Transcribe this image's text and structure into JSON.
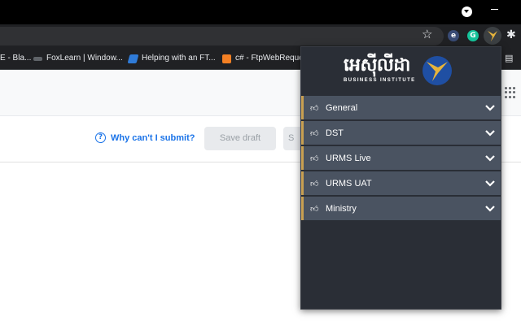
{
  "browser": {
    "bookmarks": [
      {
        "label": "E - Bla...",
        "icon": "bookmark-favicon"
      },
      {
        "label": "FoxLearn | Window...",
        "icon": "foxlearn-favicon"
      },
      {
        "label": "Helping with an FT...",
        "icon": "stackoverflow-favicon"
      },
      {
        "label": "c# - FtpWebReques",
        "icon": "stackoverflow-favicon"
      }
    ],
    "extensions": [
      {
        "name": "e-extension-icon",
        "glyph": "e"
      },
      {
        "name": "grammarly-icon",
        "glyph": "G"
      },
      {
        "name": "business-institute-extension-icon"
      }
    ]
  },
  "page": {
    "help_link": "Why can't I submit?",
    "help_glyph": "?",
    "save_draft": "Save draft",
    "submit_partial": "S"
  },
  "popup": {
    "logo_text": "អេសុីលីដា",
    "logo_sub": "BUSINESS INSTITUTE",
    "menu": [
      {
        "label": "General"
      },
      {
        "label": "DST"
      },
      {
        "label": "URMS Live"
      },
      {
        "label": "URMS UAT"
      },
      {
        "label": "Ministry"
      }
    ],
    "colors": {
      "accent": "#c8a052",
      "item_bg": "#4a5361",
      "panel_bg": "#2a2e36",
      "logo_blue": "#1f4fa3",
      "logo_gold": "#e6b43c"
    }
  }
}
